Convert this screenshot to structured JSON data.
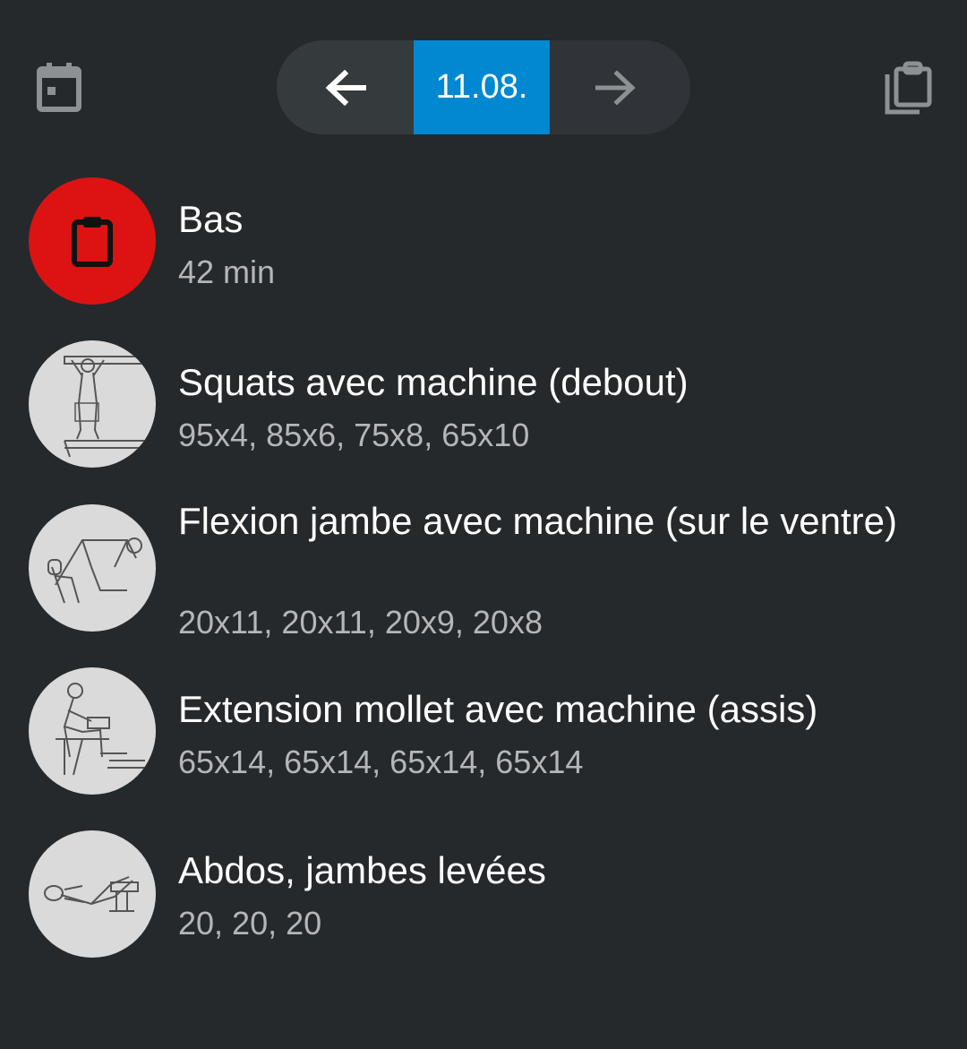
{
  "header": {
    "date_label": "11.08.",
    "icons": {
      "calendar": "calendar-icon",
      "prev": "arrow-left-icon",
      "next": "arrow-right-icon",
      "copy": "clipboard-copy-icon"
    }
  },
  "session": {
    "name": "Bas",
    "duration": "42 min",
    "icon": "clipboard-icon",
    "color": "#dd1313"
  },
  "exercises": [
    {
      "name": "Squats avec machine (debout)",
      "sets": "95x4, 85x6, 75x8, 65x10"
    },
    {
      "name": "Flexion jambe avec machine (sur le ventre)",
      "sets": "20x11, 20x11, 20x9, 20x8"
    },
    {
      "name": "Extension mollet avec machine (assis)",
      "sets": "65x14, 65x14, 65x14, 65x14"
    },
    {
      "name": "Abdos, jambes levées",
      "sets": "20, 20, 20"
    }
  ],
  "colors": {
    "background": "#26292c",
    "accent": "#0288d1"
  }
}
